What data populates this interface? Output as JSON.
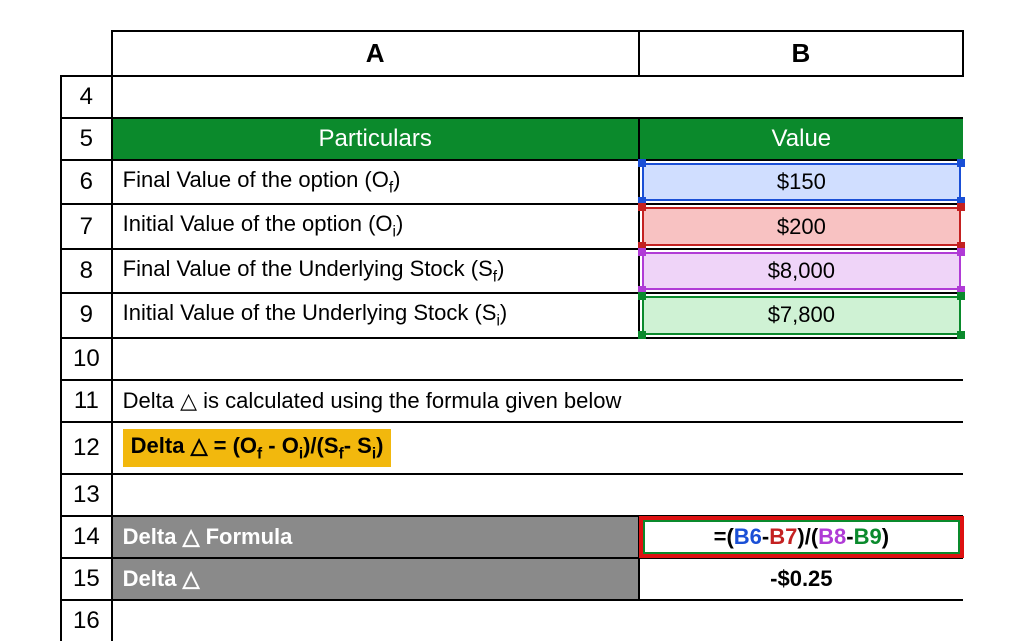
{
  "columns": {
    "A": "A",
    "B": "B"
  },
  "rows": {
    "r4": "4",
    "r5": "5",
    "r6": "6",
    "r7": "7",
    "r8": "8",
    "r9": "9",
    "r10": "10",
    "r11": "11",
    "r12": "12",
    "r13": "13",
    "r14": "14",
    "r15": "15",
    "r16": "16"
  },
  "headers": {
    "particulars": "Particulars",
    "value": "Value"
  },
  "items": {
    "of": {
      "label_pre": "Final Value of the option (O",
      "sub": "f",
      "label_post": ")",
      "value": "$150"
    },
    "oi": {
      "label_pre": "Initial Value of the option (O",
      "sub": "i",
      "label_post": ")",
      "value": "$200"
    },
    "sf": {
      "label_pre": "Final Value of the Underlying Stock (S",
      "sub": "f",
      "label_post": ")",
      "value": "$8,000"
    },
    "si": {
      "label_pre": "Initial Value of the Underlying Stock (S",
      "sub": "i",
      "label_post": ")",
      "value": "$7,800"
    }
  },
  "note": "Delta △ is calculated using the formula given below",
  "formula_text": {
    "pre": "Delta △ = (O",
    "s1": "f",
    "m1": " - O",
    "s2": "i",
    "m2": ")/(S",
    "s3": "f",
    "m3": "- S",
    "s4": "i",
    "post": ")"
  },
  "result": {
    "formula_label": "Delta △ Formula",
    "delta_label": "Delta △",
    "formula": {
      "eq": "=",
      "lp": "(",
      "b6": "B6",
      "d1": "-",
      "b7": "B7",
      "rp": ")",
      "sl": "/",
      "lp2": "(",
      "b8": "B8",
      "d2": "-",
      "b9": "B9",
      "rp2": ")"
    },
    "value": "-$0.25"
  }
}
